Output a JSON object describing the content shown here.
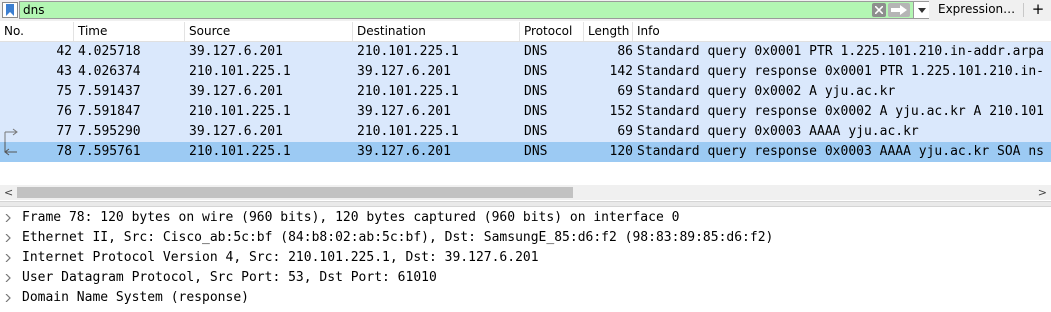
{
  "filter": {
    "value": "dns",
    "expression_label": "Expression…",
    "add_label": "+"
  },
  "packet_list": {
    "columns": [
      "No.",
      "Time",
      "Source",
      "Destination",
      "Protocol",
      "Length",
      "Info"
    ],
    "rows": [
      {
        "no": "42",
        "time": "4.025718",
        "source": "39.127.6.201",
        "destination": "210.101.225.1",
        "protocol": "DNS",
        "length": "86",
        "info": "Standard query 0x0001 PTR 1.225.101.210.in-addr.arpa"
      },
      {
        "no": "43",
        "time": "4.026374",
        "source": "210.101.225.1",
        "destination": "39.127.6.201",
        "protocol": "DNS",
        "length": "142",
        "info": "Standard query response 0x0001 PTR 1.225.101.210.in-"
      },
      {
        "no": "75",
        "time": "7.591437",
        "source": "39.127.6.201",
        "destination": "210.101.225.1",
        "protocol": "DNS",
        "length": "69",
        "info": "Standard query 0x0002 A yju.ac.kr"
      },
      {
        "no": "76",
        "time": "7.591847",
        "source": "210.101.225.1",
        "destination": "39.127.6.201",
        "protocol": "DNS",
        "length": "152",
        "info": "Standard query response 0x0002 A yju.ac.kr A 210.101"
      },
      {
        "no": "77",
        "time": "7.595290",
        "source": "39.127.6.201",
        "destination": "210.101.225.1",
        "protocol": "DNS",
        "length": "69",
        "info": "Standard query 0x0003 AAAA yju.ac.kr"
      },
      {
        "no": "78",
        "time": "7.595761",
        "source": "210.101.225.1",
        "destination": "39.127.6.201",
        "protocol": "DNS",
        "length": "120",
        "info": "Standard query response 0x0003 AAAA yju.ac.kr SOA ns"
      }
    ],
    "selected_row": "78"
  },
  "scrollbar": {
    "left_arrow": "<",
    "right_arrow": ">"
  },
  "details": {
    "lines": [
      "Frame 78: 120 bytes on wire (960 bits), 120 bytes captured (960 bits) on interface 0",
      "Ethernet II, Src: Cisco_ab:5c:bf (84:b8:02:ab:5c:bf), Dst: SamsungE_85:d6:f2 (98:83:89:85:d6:f2)",
      "Internet Protocol Version 4, Src: 210.101.225.1, Dst: 39.127.6.201",
      "User Datagram Protocol, Src Port: 53, Dst Port: 61010",
      "Domain Name System (response)"
    ]
  },
  "colors": {
    "filter_valid": "#b3f6b3",
    "row_bg": "#dae8fc",
    "row_selected": "#9ccaf3"
  },
  "icons": {
    "bookmark": "bookmark-icon",
    "clear": "clear-filter-icon",
    "apply": "apply-filter-arrow-icon",
    "history": "chevron-down-icon",
    "request_arrow": "related-request-arrow-icon",
    "response_arrow": "related-response-arrow-icon",
    "expand": "chevron-right-icon"
  }
}
